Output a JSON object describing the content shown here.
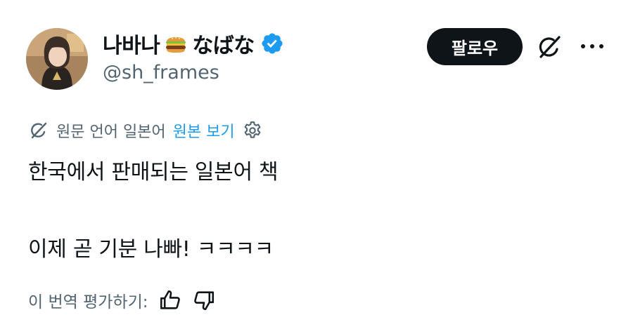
{
  "author": {
    "display_name": "나바나",
    "display_name_suffix": "なばな",
    "emoji": "burger-emoji",
    "handle": "@sh_frames",
    "verified": true
  },
  "actions": {
    "follow_label": "팔로우",
    "grok_icon": "grok-icon",
    "more_icon": "more-icon"
  },
  "translation": {
    "info_text": "원문 언어 일본어",
    "show_original_label": "원본 보기",
    "settings_icon": "gear-icon"
  },
  "tweet": {
    "lines": [
      "한국에서 판매되는 일본어 책",
      "이제 곧 기분 나빠! ㅋㅋㅋㅋ"
    ]
  },
  "rating": {
    "prompt": "이 번역 평가하기:",
    "like_icon": "thumbs-up-icon",
    "dislike_icon": "thumbs-down-icon"
  },
  "colors": {
    "text_primary": "#0f1419",
    "text_secondary": "#536471",
    "link": "#1d9bf0",
    "verified": "#1d9bf0",
    "follow_bg": "#0f1419"
  }
}
